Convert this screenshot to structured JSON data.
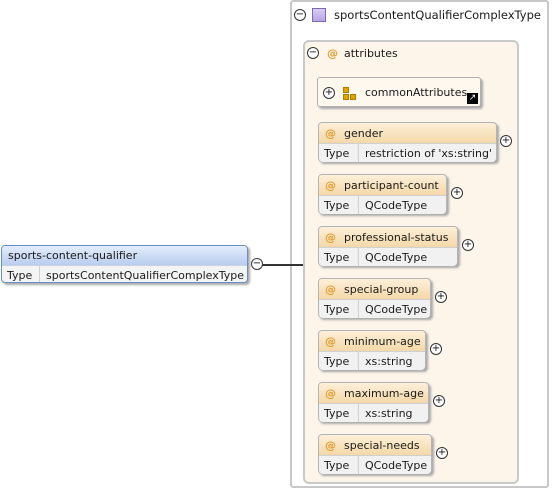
{
  "element": {
    "name": "sports-content-qualifier",
    "type_key": "Type",
    "type_value": "sportsContentQualifierComplexType"
  },
  "complex_type": {
    "title": "sportsContentQualifierComplexType"
  },
  "attributes_group": {
    "at_symbol": "@",
    "label": "attributes",
    "group_ref": {
      "label": "commonAttributes"
    },
    "items": [
      {
        "name": "gender",
        "type_key": "Type",
        "type_value": "restriction of 'xs:string'"
      },
      {
        "name": "participant-count",
        "type_key": "Type",
        "type_value": "QCodeType"
      },
      {
        "name": "professional-status",
        "type_key": "Type",
        "type_value": "QCodeType"
      },
      {
        "name": "special-group",
        "type_key": "Type",
        "type_value": "QCodeType"
      },
      {
        "name": "minimum-age",
        "type_key": "Type",
        "type_value": "xs:string"
      },
      {
        "name": "maximum-age",
        "type_key": "Type",
        "type_value": "xs:string"
      },
      {
        "name": "special-needs",
        "type_key": "Type",
        "type_value": "QCodeType"
      }
    ]
  },
  "symbols": {
    "collapse": "−",
    "expand": "+",
    "ref_arrow": "↗"
  },
  "colors": {
    "attribute_accent": "#e59b2d",
    "element_border": "#6a8ec8",
    "attribute_bg": "#fdf5ea"
  }
}
